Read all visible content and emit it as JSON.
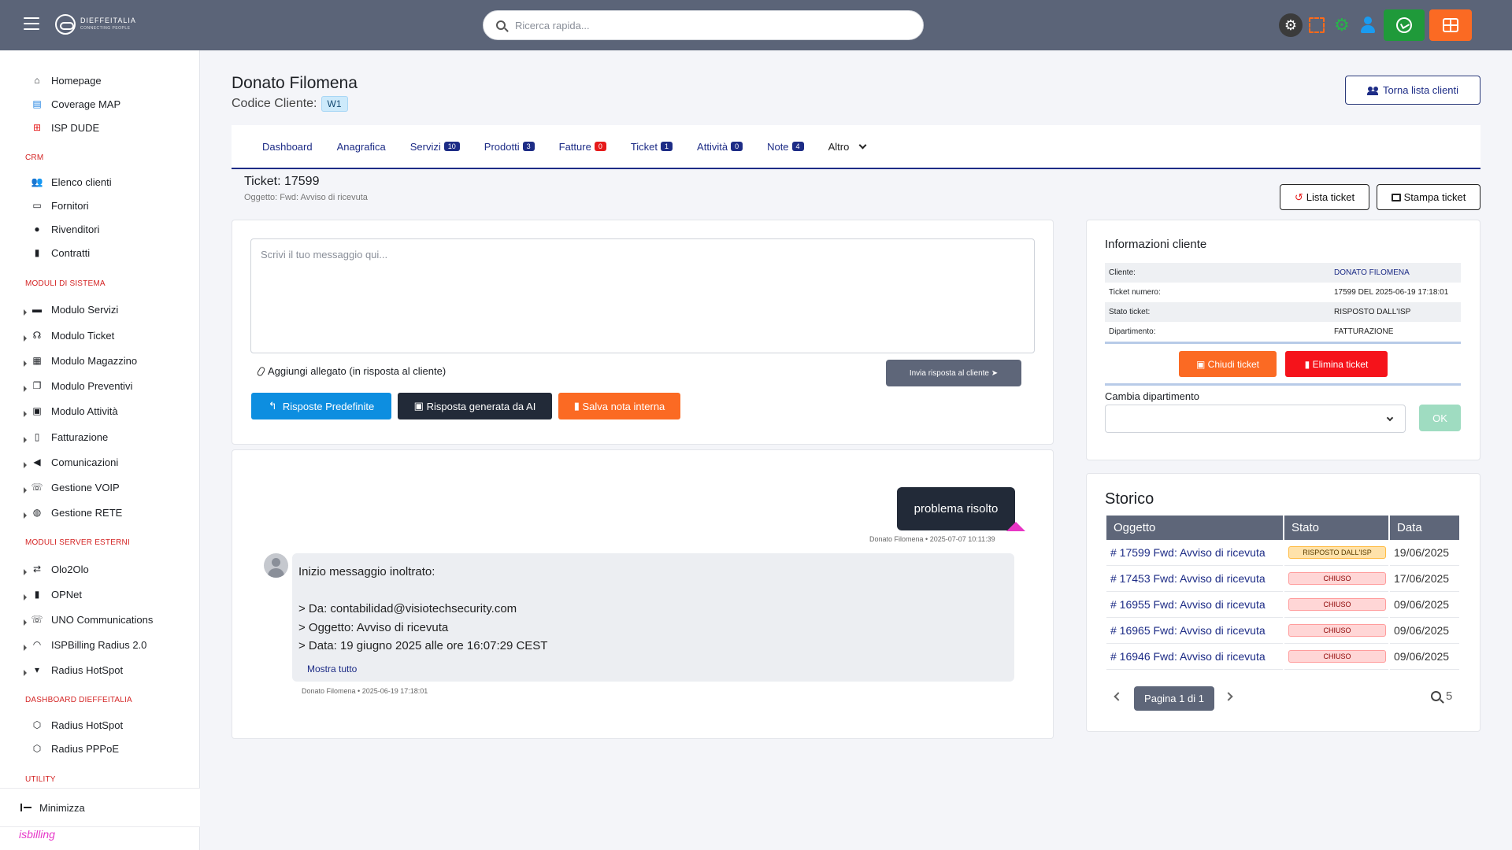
{
  "topbar": {
    "logo_text": "DIEFFEITALIA",
    "logo_sub": "CONNECTING PEOPLE",
    "search_placeholder": "Ricerca rapida..."
  },
  "sidebar": {
    "top_items": [
      {
        "label": "Homepage",
        "icon": "home-icon"
      },
      {
        "label": "Coverage MAP",
        "icon": "map-icon"
      },
      {
        "label": "ISP DUDE",
        "icon": "network-icon"
      }
    ],
    "crm_title": "CRM",
    "crm_items": [
      {
        "label": "Elenco clienti",
        "icon": "users-icon"
      },
      {
        "label": "Fornitori",
        "icon": "store-icon"
      },
      {
        "label": "Rivenditori",
        "icon": "user-tie-icon"
      },
      {
        "label": "Contratti",
        "icon": "file-icon"
      }
    ],
    "moduli_title": "MODULI DI SISTEMA",
    "moduli_items": [
      {
        "label": "Modulo Servizi",
        "icon": "server-icon"
      },
      {
        "label": "Modulo Ticket",
        "icon": "headset-icon"
      },
      {
        "label": "Modulo Magazzino",
        "icon": "boxes-icon"
      },
      {
        "label": "Modulo Preventivi",
        "icon": "copy-icon"
      },
      {
        "label": "Modulo Attività",
        "icon": "tasks-icon"
      },
      {
        "label": "Fatturazione",
        "icon": "invoice-icon"
      },
      {
        "label": "Comunicazioni",
        "icon": "megaphone-icon"
      },
      {
        "label": "Gestione VOIP",
        "icon": "phone-icon"
      },
      {
        "label": "Gestione RETE",
        "icon": "globe-icon"
      }
    ],
    "esterni_title": "MODULI SERVER ESTERNI",
    "esterni_items": [
      {
        "label": "Olo2Olo",
        "icon": "exchange-icon"
      },
      {
        "label": "OPNet",
        "icon": "file-icon"
      },
      {
        "label": "UNO Communications",
        "icon": "phone-icon"
      },
      {
        "label": "ISPBilling Radius 2.0",
        "icon": "wifi-icon"
      },
      {
        "label": "Radius HotSpot",
        "icon": "mug-icon"
      }
    ],
    "dashboard_title": "DASHBOARD DIEFFEITALIA",
    "dashboard_items": [
      {
        "label": "Radius HotSpot",
        "icon": "cube-icon"
      },
      {
        "label": "Radius PPPoE",
        "icon": "cube-icon"
      }
    ],
    "utility_title": "UTILITY",
    "minimize_label": "Minimizza",
    "brand_label": "isbilling"
  },
  "client": {
    "name": "Donato Filomena",
    "code_label": "Codice Cliente:",
    "code": "W1",
    "back_label": "Torna lista clienti"
  },
  "tabs": [
    {
      "label": "Dashboard",
      "badge": ""
    },
    {
      "label": "Anagrafica",
      "badge": ""
    },
    {
      "label": "Servizi",
      "badge": "10"
    },
    {
      "label": "Prodotti",
      "badge": "3"
    },
    {
      "label": "Fatture",
      "badge": "0"
    },
    {
      "label": "Ticket",
      "badge": "1"
    },
    {
      "label": "Attività",
      "badge": "0"
    },
    {
      "label": "Note",
      "badge": "4"
    },
    {
      "label": "Altro",
      "badge": ""
    }
  ],
  "ticket": {
    "title": "Ticket: 17599",
    "subject": "Oggetto: Fwd: Avviso di ricevuta",
    "list_label": "Lista ticket",
    "print_label": "Stampa ticket"
  },
  "composer": {
    "placeholder": "Scrivi il tuo messaggio qui...",
    "attach_label": "Aggiungi allegato (in risposta al cliente)",
    "send_label": "Invia risposta al cliente",
    "predefinite_label": "Risposte Predefinite",
    "ai_label": "Risposta generata da AI",
    "nota_label": "Salva nota interna"
  },
  "messages": {
    "right_text": "problema risolto",
    "right_meta": "Donato Filomena • 2025-07-07 10:11:39",
    "left_lines": [
      "Inizio messaggio inoltrato:",
      "",
      "> Da: contabilidad@visiotechsecurity.com",
      "> Oggetto: Avviso di ricevuta",
      "> Data: 19 giugno 2025 alle ore 16:07:29 CEST"
    ],
    "left_more": "Mostra tutto",
    "left_meta": "Donato Filomena • 2025-06-19 17:18:01"
  },
  "info": {
    "title": "Informazioni cliente",
    "rows": [
      {
        "label": "Cliente:",
        "value": "DONATO FILOMENA"
      },
      {
        "label": "Ticket numero:",
        "value": "17599 DEL 2025-06-19 17:18:01"
      },
      {
        "label": "Stato ticket:",
        "value": "RISPOSTO DALL'ISP"
      },
      {
        "label": "Dipartimento:",
        "value": "FATTURAZIONE"
      }
    ],
    "close_label": "Chiudi ticket",
    "delete_label": "Elimina ticket",
    "cambia_label": "Cambia dipartimento",
    "ok_label": "OK"
  },
  "storico": {
    "title": "Storico",
    "headers": [
      "Oggetto",
      "Stato",
      "Data"
    ],
    "rows": [
      {
        "obj": "# 17599 Fwd: Avviso di ricevuta",
        "stato": "RISPOSTO DALL'ISP",
        "data": "19/06/2025"
      },
      {
        "obj": "# 17453 Fwd: Avviso di ricevuta",
        "stato": "CHIUSO",
        "data": "17/06/2025"
      },
      {
        "obj": "# 16955 Fwd: Avviso di ricevuta",
        "stato": "CHIUSO",
        "data": "09/06/2025"
      },
      {
        "obj": "# 16965 Fwd: Avviso di ricevuta",
        "stato": "CHIUSO",
        "data": "09/06/2025"
      },
      {
        "obj": "# 16946 Fwd: Avviso di ricevuta",
        "stato": "CHIUSO",
        "data": "09/06/2025"
      }
    ],
    "page_label": "Pagina 1 di 1",
    "count": "5"
  },
  "colors": {
    "topbar": "#5b6478",
    "primary": "#1d2c86",
    "orange": "#fb6a23",
    "red": "#e61b1b",
    "blue": "#0d8ee0",
    "dark": "#222a38"
  }
}
